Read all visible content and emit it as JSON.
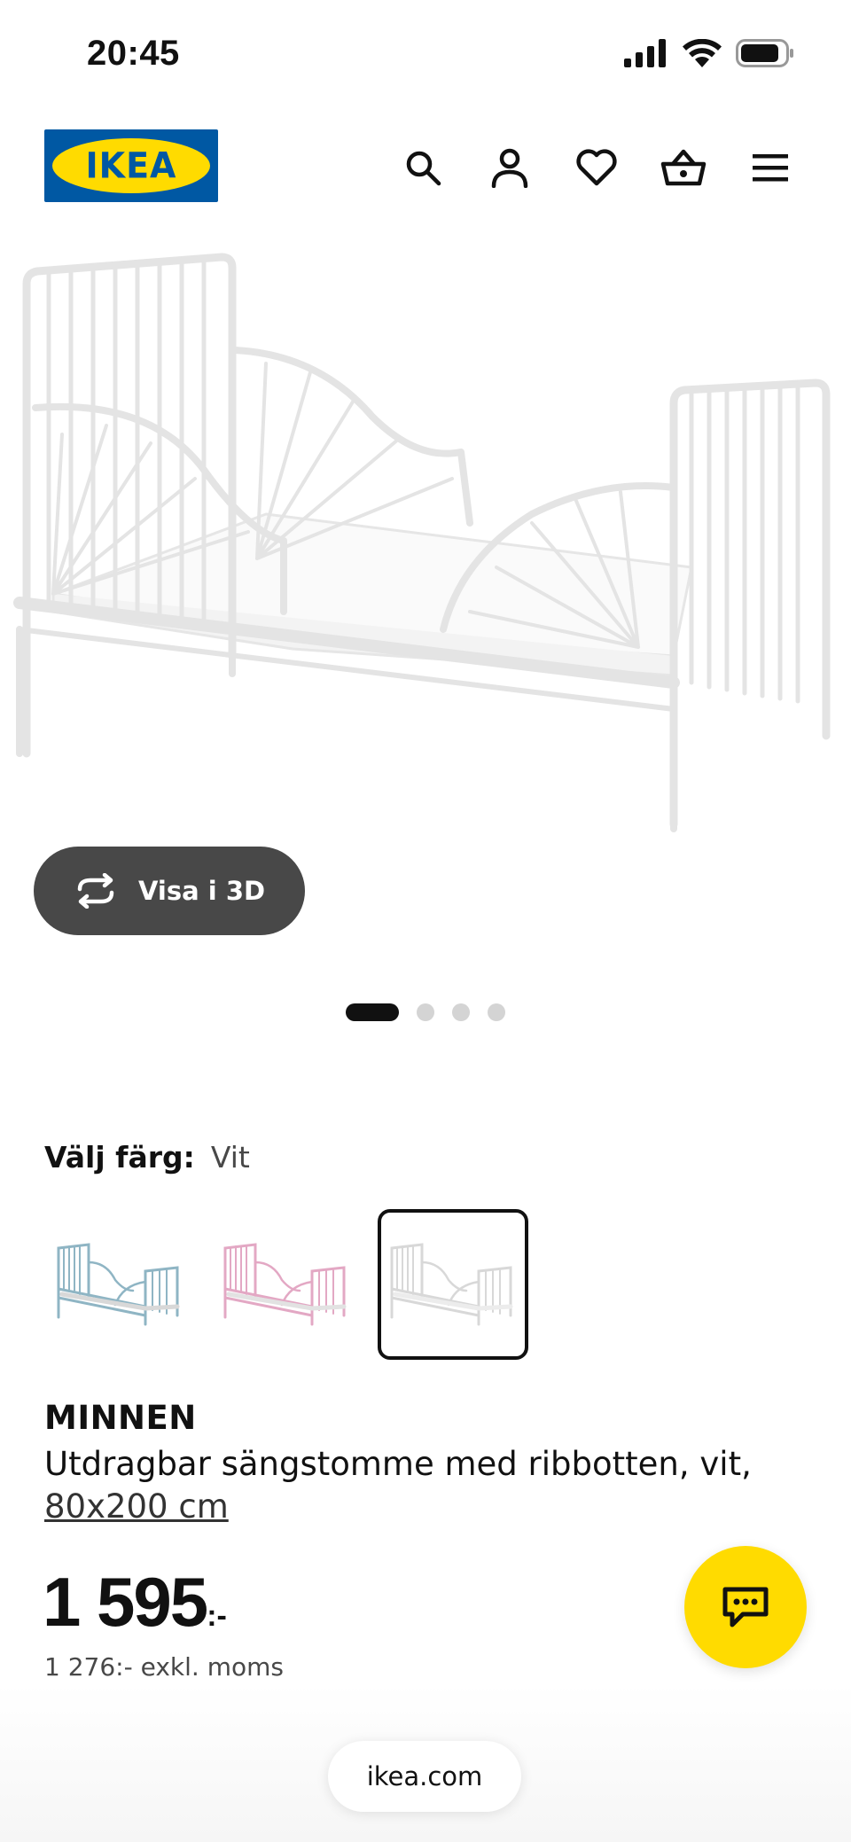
{
  "status_bar": {
    "time": "20:45"
  },
  "header": {
    "logo_text": "IKEA",
    "nav_icons": [
      "search-icon",
      "account-icon",
      "heart-icon",
      "basket-icon",
      "menu-icon"
    ]
  },
  "gallery": {
    "view_3d_label": "Visa i 3D",
    "image_count": 4,
    "active_index": 0
  },
  "color_picker": {
    "label": "Välj färg:",
    "selected_value": "Vit",
    "options": [
      {
        "name": "light-blue",
        "color": "#8fb5c4"
      },
      {
        "name": "pink",
        "color": "#e3a8c4"
      },
      {
        "name": "white",
        "color": "#e2e2e2"
      }
    ],
    "selected_index": 2
  },
  "product": {
    "name": "MINNEN",
    "description": "Utdragbar sängstomme med ribbotten, vit,",
    "size": "80x200 cm",
    "price_main": "1 595",
    "price_suffix": ":-",
    "price_excl_vat": "1 276:- exkl. moms"
  },
  "browser": {
    "url": "ikea.com"
  },
  "colors": {
    "brand_blue": "#0058a3",
    "brand_yellow": "#ffdb00",
    "pill_dark": "#484848"
  }
}
